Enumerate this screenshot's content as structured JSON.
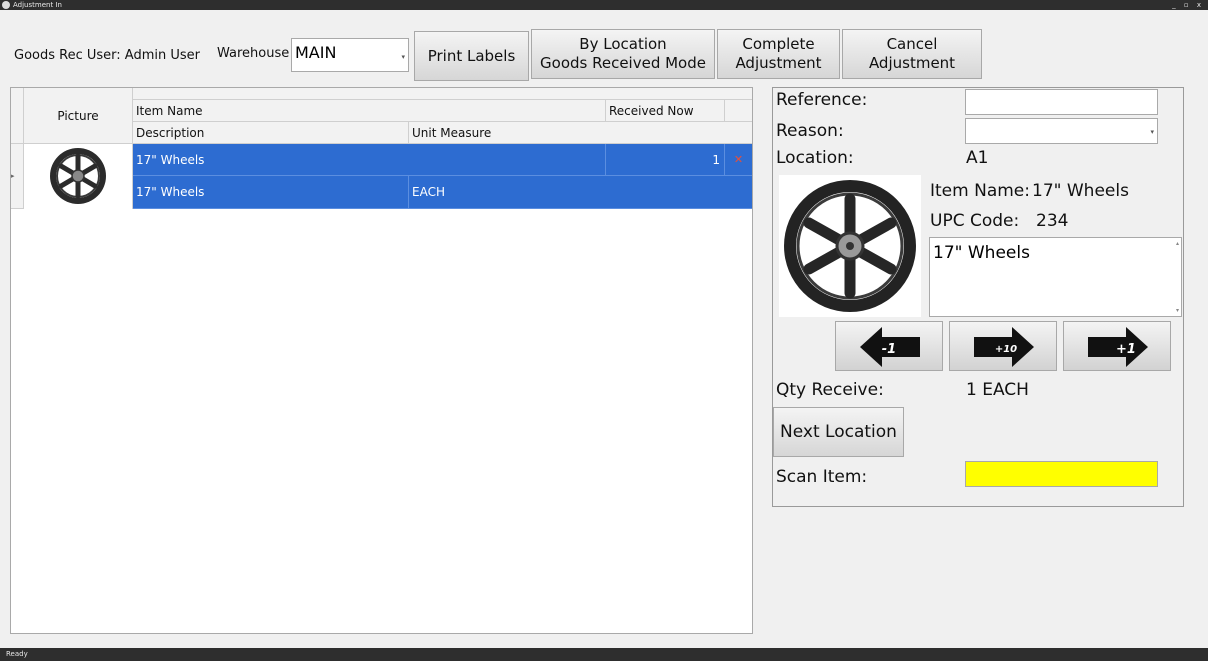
{
  "window": {
    "title": "Adjustment In",
    "controls": "_ ▫ x",
    "status": "Ready"
  },
  "toolbar": {
    "user_label": "Goods Rec User: Admin User",
    "warehouse_label": "Warehouse",
    "warehouse_value": "MAIN",
    "buttons": {
      "print_labels": "Print Labels",
      "by_location": "By Location\nGoods Received Mode",
      "complete": "Complete\nAdjustment",
      "cancel": "Cancel\nAdjustment"
    }
  },
  "grid": {
    "headers": {
      "picture": "Picture",
      "item_name": "Item Name",
      "received_now": "Received Now",
      "description": "Description",
      "unit_measure": "Unit Measure"
    },
    "rows": [
      {
        "item_name": "17\" Wheels",
        "received_now": "1",
        "description": "17\" Wheels",
        "unit_measure": "EACH",
        "selected": true
      }
    ]
  },
  "detail": {
    "reference_label": "Reference:",
    "reference_value": "",
    "reason_label": "Reason:",
    "reason_value": "",
    "location_label": "Location:",
    "location_value": "A1",
    "item_name_label": "Item Name:",
    "item_name_value": "17\" Wheels",
    "upc_label": "UPC Code:",
    "upc_value": "234",
    "description_value": "17\" Wheels",
    "qty_buttons": [
      "-1",
      "+10",
      "+1"
    ],
    "qty_label": "Qty Receive:",
    "qty_value": "1 EACH",
    "next_location": "Next Location",
    "scan_label": "Scan Item:",
    "scan_value": ""
  },
  "colors": {
    "selection": "#2d6cd1",
    "scan_field": "#ffff00",
    "titlebar": "#2e2e2e"
  }
}
